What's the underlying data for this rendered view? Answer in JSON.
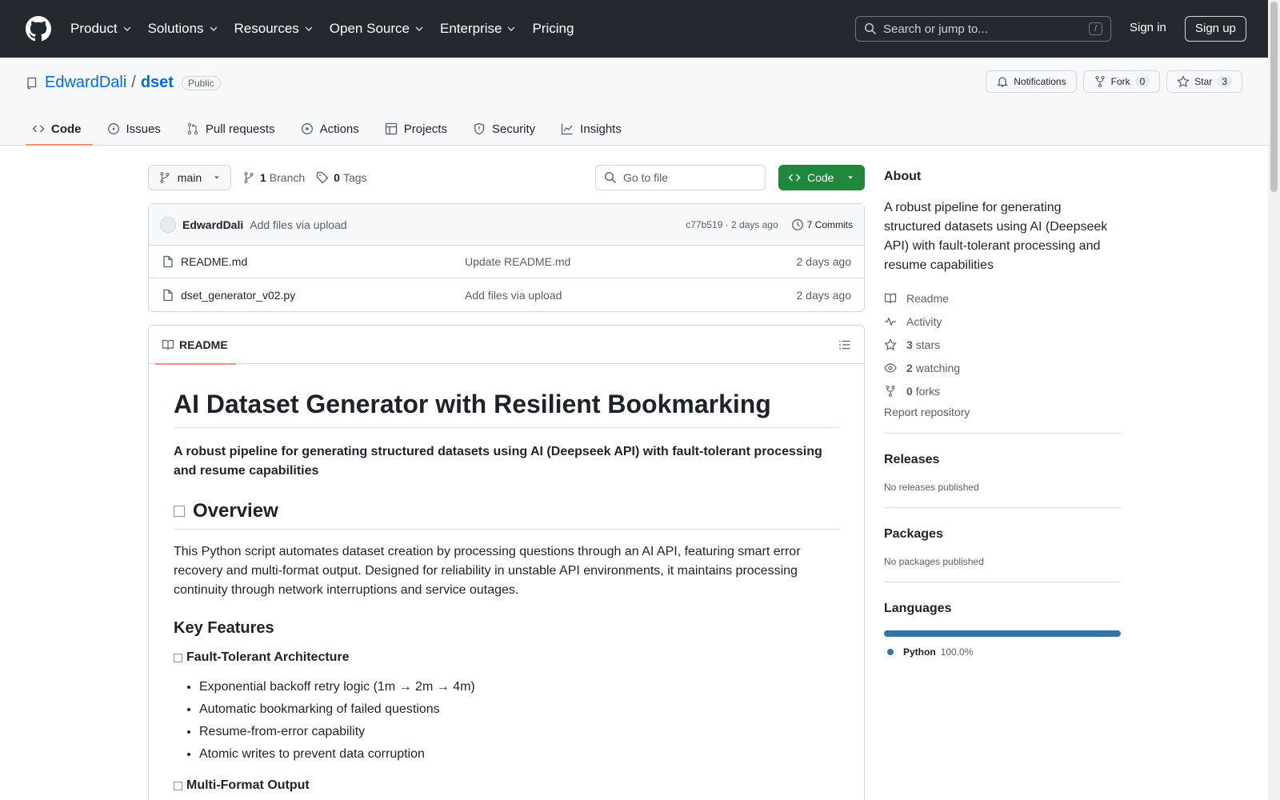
{
  "header": {
    "nav": [
      {
        "label": "Product",
        "has_menu": true
      },
      {
        "label": "Solutions",
        "has_menu": true
      },
      {
        "label": "Resources",
        "has_menu": true
      },
      {
        "label": "Open Source",
        "has_menu": true
      },
      {
        "label": "Enterprise",
        "has_menu": true
      },
      {
        "label": "Pricing",
        "has_menu": false
      }
    ],
    "search_placeholder": "Search or jump to...",
    "search_shortcut": "/",
    "sign_in": "Sign in",
    "sign_up": "Sign up"
  },
  "repo": {
    "owner": "EdwardDali",
    "separator": "/",
    "name": "dset",
    "visibility": "Public",
    "notifications_label": "Notifications",
    "fork_label": "Fork",
    "fork_count": "0",
    "star_label": "Star",
    "star_count": "3"
  },
  "tabs": [
    {
      "label": "Code",
      "icon": "code-icon",
      "active": true
    },
    {
      "label": "Issues",
      "icon": "issue-icon",
      "active": false
    },
    {
      "label": "Pull requests",
      "icon": "pull-request-icon",
      "active": false
    },
    {
      "label": "Actions",
      "icon": "play-icon",
      "active": false
    },
    {
      "label": "Projects",
      "icon": "table-icon",
      "active": false
    },
    {
      "label": "Security",
      "icon": "shield-icon",
      "active": false
    },
    {
      "label": "Insights",
      "icon": "graph-icon",
      "active": false
    }
  ],
  "toolbar": {
    "branch": "main",
    "branch_count": "1",
    "branch_label": "Branch",
    "tag_count": "0",
    "tag_label": "Tags",
    "goto_placeholder": "Go to file",
    "code_button": "Code"
  },
  "commit": {
    "author": "EdwardDali",
    "message": "Add files via upload",
    "meta": "c77b519 · 2 days ago",
    "commits_label": "7 Commits"
  },
  "files": [
    {
      "name": "README.md",
      "message": "Update README.md",
      "age": "2 days ago"
    },
    {
      "name": "dset_generator_v02.py",
      "message": "Add files via upload",
      "age": "2 days ago"
    }
  ],
  "readme": {
    "tab_label": "README",
    "title": "AI Dataset Generator with Resilient Bookmarking",
    "subtitle": "A robust pipeline for generating structured datasets using AI (Deepseek API) with fault-tolerant processing and resume capabilities",
    "overview_heading": "Overview",
    "overview_text": "This Python script automates dataset creation by processing questions through an AI API, featuring smart error recovery and multi-format output. Designed for reliability in unstable API environments, it maintains processing continuity through network interruptions and service outages.",
    "key_features_heading": "Key Features",
    "feature1_title": "Fault-Tolerant Architecture",
    "feature1_items": [
      "Exponential backoff retry logic (1m → 2m → 4m)",
      "Automatic bookmarking of failed questions",
      "Resume-from-error capability",
      "Atomic writes to prevent data corruption"
    ],
    "feature2_title": "Multi-Format Output"
  },
  "sidebar": {
    "about_heading": "About",
    "description": "A robust pipeline for generating structured datasets using AI (Deepseek API) with fault-tolerant processing and resume capabilities",
    "readme": "Readme",
    "activity": "Activity",
    "stars_count": "3",
    "stars_label": "stars",
    "watching_count": "2",
    "watching_label": "watching",
    "forks_count": "0",
    "forks_label": "forks",
    "report": "Report repository",
    "releases_heading": "Releases",
    "releases_text": "No releases published",
    "packages_heading": "Packages",
    "packages_text": "No packages published",
    "languages_heading": "Languages",
    "language_name": "Python",
    "language_pct": "100.0%",
    "language_color": "#3572A5"
  }
}
